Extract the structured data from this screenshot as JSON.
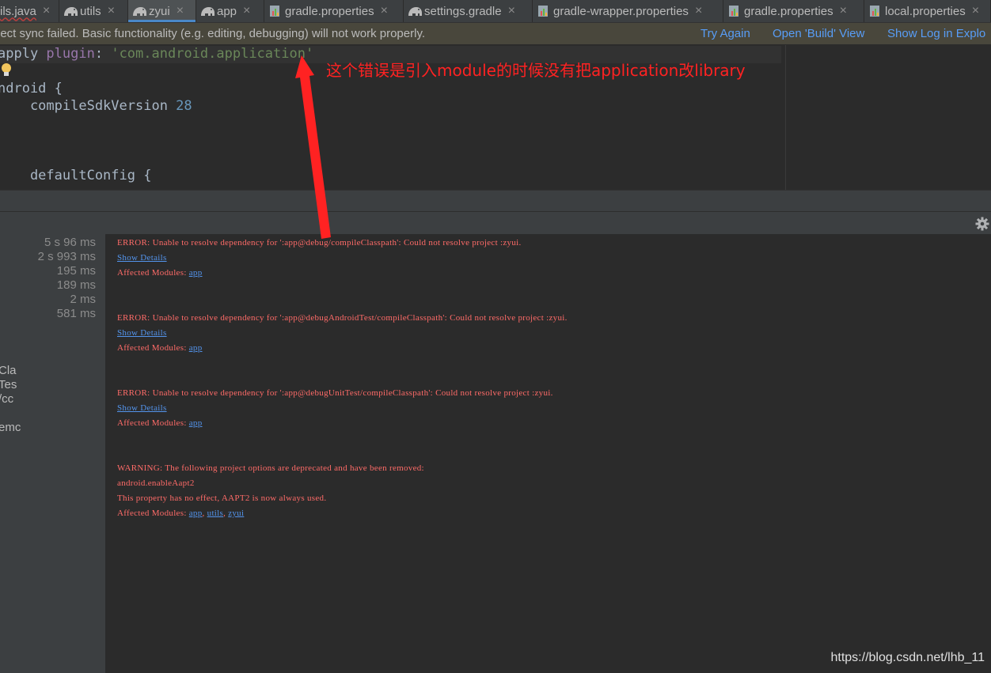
{
  "tabs": [
    {
      "label": "ils.java",
      "icon": "java-file-icon",
      "active": false,
      "error": true
    },
    {
      "label": "utils",
      "icon": "gradle-elephant-icon",
      "active": false,
      "error": false
    },
    {
      "label": "zyui",
      "icon": "gradle-elephant-icon",
      "active": true,
      "error": false
    },
    {
      "label": "app",
      "icon": "gradle-elephant-icon",
      "active": false,
      "error": false
    },
    {
      "label": "gradle.properties",
      "icon": "properties-file-icon",
      "active": false,
      "error": false
    },
    {
      "label": "settings.gradle",
      "icon": "gradle-elephant-icon",
      "active": false,
      "error": false
    },
    {
      "label": "gradle-wrapper.properties",
      "icon": "properties-file-icon",
      "active": false,
      "error": false
    },
    {
      "label": "gradle.properties",
      "icon": "properties-file-icon",
      "active": false,
      "error": false
    },
    {
      "label": "local.properties",
      "icon": "properties-file-icon",
      "active": false,
      "error": false
    }
  ],
  "tab_close_glyph": "×",
  "notification": {
    "message": "ject sync failed. Basic functionality (e.g. editing, debugging) will not work properly.",
    "actions": [
      "Try Again",
      "Open 'Build' View",
      "Show Log in Explo"
    ]
  },
  "editor": {
    "line1": {
      "kw": "apply",
      "plugin": " plugin",
      "colon": ": ",
      "str": "'com.android.application'"
    },
    "line2": "ndroid {",
    "line3": {
      "name": "    compileSdkVersion ",
      "num": "28"
    },
    "line4": "    defaultConfig {"
  },
  "annotation": "这个错误是引入module的时候没有把application改library",
  "build_tree": {
    "times": [
      "5 s 96 ms",
      "2 s 993 ms",
      "195 ms",
      "189 ms",
      "2 ms",
      "581 ms"
    ],
    "truncated": [
      "Cla",
      "Tes",
      "/cc",
      "emc"
    ]
  },
  "console": {
    "blocks": [
      {
        "error": "ERROR: Unable to resolve dependency for ':app@debug/compileClasspath': Could not resolve project :zyui.",
        "details": "Show Details",
        "modules_label": "Affected Modules: ",
        "modules": [
          "app"
        ]
      },
      {
        "error": "ERROR: Unable to resolve dependency for ':app@debugAndroidTest/compileClasspath': Could not resolve project :zyui.",
        "details": "Show Details",
        "modules_label": "Affected Modules: ",
        "modules": [
          "app"
        ]
      },
      {
        "error": "ERROR: Unable to resolve dependency for ':app@debugUnitTest/compileClasspath': Could not resolve project :zyui.",
        "details": "Show Details",
        "modules_label": "Affected Modules: ",
        "modules": [
          "app"
        ]
      }
    ],
    "warning": {
      "line1": "WARNING: The following project options are deprecated and have been removed:",
      "line2": "android.enableAapt2",
      "line3": "This property has no effect, AAPT2 is now always used.",
      "modules_label": "Affected Modules: ",
      "modules": [
        "app",
        "utils",
        "zyui"
      ]
    }
  },
  "watermark": "https://blog.csdn.net/lhb_11",
  "colors": {
    "accent": "#4a88c7",
    "error_text": "#ff6b68",
    "link": "#5394ec",
    "annotation": "#ff2222"
  }
}
